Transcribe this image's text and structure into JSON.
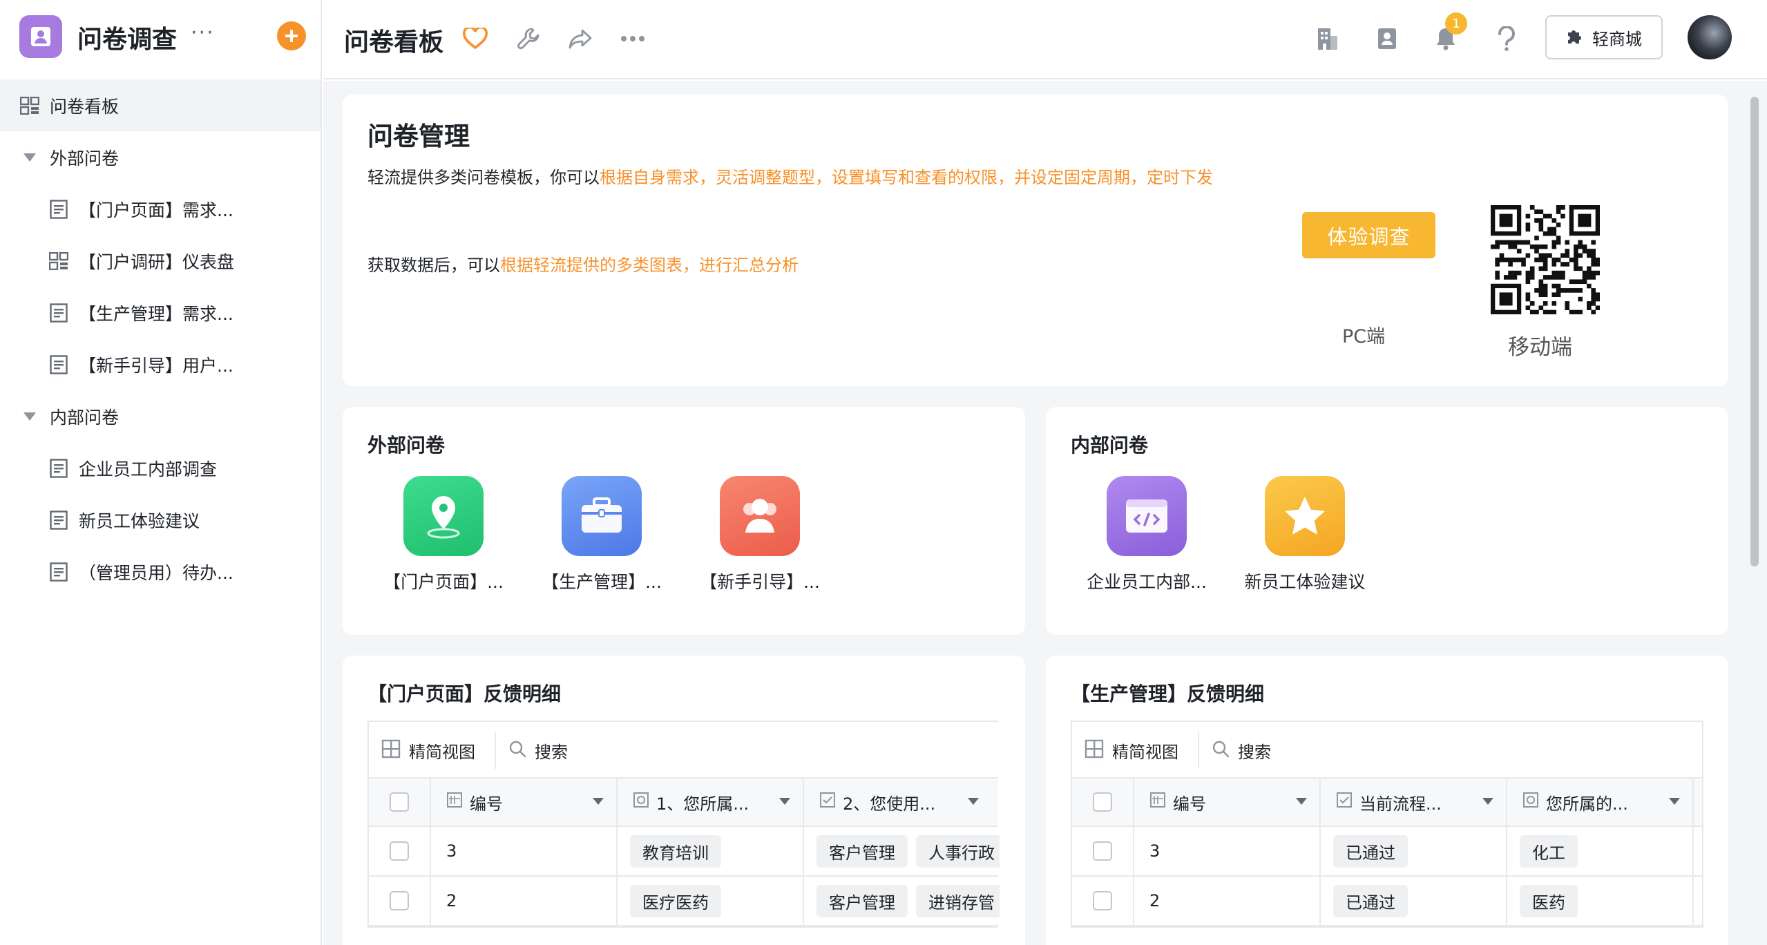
{
  "app": {
    "name": "问卷调查",
    "more": "···",
    "add": "+"
  },
  "sidebar": {
    "items": [
      {
        "label": "问卷看板",
        "icon": "dashboard-icon"
      },
      {
        "label": "外部问卷",
        "icon": "caret-down-icon"
      },
      {
        "label": "【门户页面】需求...",
        "icon": "form-icon"
      },
      {
        "label": "【门户调研】仪表盘",
        "icon": "dashboard-icon"
      },
      {
        "label": "【生产管理】需求...",
        "icon": "form-icon"
      },
      {
        "label": "【新手引导】用户...",
        "icon": "form-icon"
      },
      {
        "label": "内部问卷",
        "icon": "caret-down-icon"
      },
      {
        "label": "企业员工内部调查",
        "icon": "form-icon"
      },
      {
        "label": "新员工体验建议",
        "icon": "form-icon"
      },
      {
        "label": "（管理员用）待办...",
        "icon": "form-icon"
      }
    ]
  },
  "topbar": {
    "title": "问卷看板",
    "notification_count": "1",
    "shop_label": "轻商城"
  },
  "intro": {
    "title": "问卷管理",
    "line1_prefix": "轻流提供多类问卷模板，你可以",
    "line1_highlight": "根据自身需求，灵活调整题型，设置填写和查看的权限，并设定固定周期，定时下发",
    "line2_prefix": "获取数据后，可以",
    "line2_highlight": "根据轻流提供的多类图表，进行汇总分析",
    "try_button": "体验调查",
    "pc_label": "PC端",
    "mobile_label": "移动端"
  },
  "external": {
    "title": "外部问卷",
    "apps": [
      {
        "label": "【门户页面】...",
        "color": "#2ccf7e",
        "icon": "location-pin-icon"
      },
      {
        "label": "【生产管理】...",
        "color": "#5b8def",
        "icon": "briefcase-icon"
      },
      {
        "label": "【新手引导】...",
        "color": "#f2705a",
        "icon": "users-icon"
      }
    ]
  },
  "internal": {
    "title": "内部问卷",
    "apps": [
      {
        "label": "企业员工内部...",
        "color": "#9b6fe0",
        "icon": "code-window-icon"
      },
      {
        "label": "新员工体验建议",
        "color": "#f7b731",
        "icon": "star-icon"
      }
    ]
  },
  "table_left": {
    "title": "【门户页面】反馈明细",
    "view_label": "精简视图",
    "search_label": "搜索",
    "columns": [
      "编号",
      "1、您所属...",
      "2、您使用..."
    ],
    "rows": [
      {
        "id": "3",
        "c1": "教育培训",
        "c2": [
          "客户管理",
          "人事行政"
        ]
      },
      {
        "id": "2",
        "c1": "医疗医药",
        "c2": [
          "客户管理",
          "进销存管"
        ]
      }
    ]
  },
  "table_right": {
    "title": "【生产管理】反馈明细",
    "view_label": "精简视图",
    "search_label": "搜索",
    "columns": [
      "编号",
      "当前流程...",
      "您所属的..."
    ],
    "rows": [
      {
        "id": "3",
        "c1": "已通过",
        "c2": "化工"
      },
      {
        "id": "2",
        "c1": "已通过",
        "c2": "医药"
      }
    ]
  }
}
